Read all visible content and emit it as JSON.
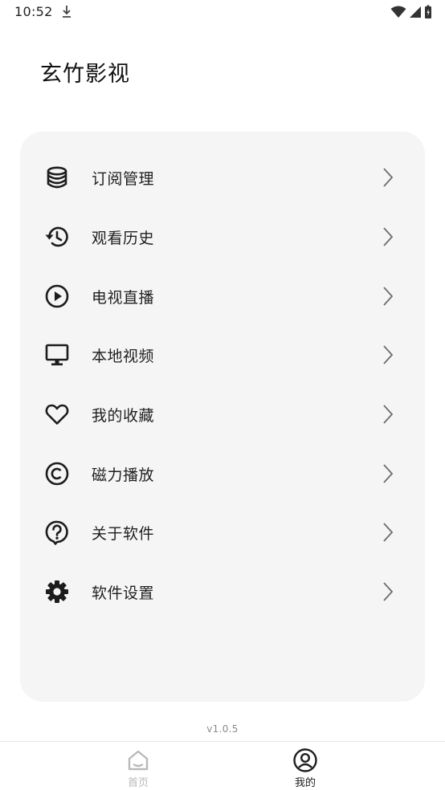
{
  "status_bar": {
    "time": "10:52"
  },
  "header": {
    "title": "玄竹影视"
  },
  "menu": {
    "items": [
      {
        "label": "订阅管理",
        "icon": "database-icon"
      },
      {
        "label": "观看历史",
        "icon": "history-icon"
      },
      {
        "label": "电视直播",
        "icon": "play-circle-icon"
      },
      {
        "label": "本地视频",
        "icon": "monitor-icon"
      },
      {
        "label": "我的收藏",
        "icon": "heart-icon"
      },
      {
        "label": "磁力播放",
        "icon": "copyright-icon"
      },
      {
        "label": "关于软件",
        "icon": "help-bubble-icon"
      },
      {
        "label": "软件设置",
        "icon": "gear-icon"
      }
    ]
  },
  "version": "v1.0.5",
  "bottom_nav": {
    "tabs": [
      {
        "label": "首页",
        "icon": "home-icon",
        "active": false
      },
      {
        "label": "我的",
        "icon": "user-circle-icon",
        "active": true
      }
    ]
  },
  "colors": {
    "card_background": "#f5f5f5",
    "inactive_tab": "#b9b9b9",
    "active_tab": "#1e1e1e"
  }
}
